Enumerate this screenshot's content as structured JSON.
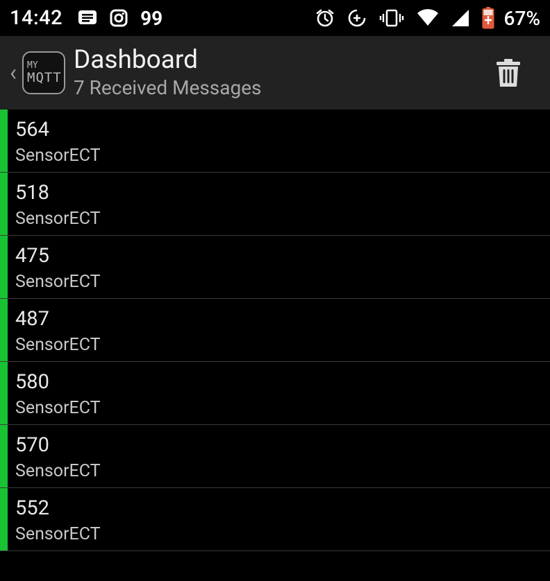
{
  "status_bar": {
    "time": "14:42",
    "notifications": [
      "message-icon",
      "instagram-icon"
    ],
    "badge_text": "99",
    "system_icons": [
      "alarm-icon",
      "data-saver-icon",
      "vibrate-icon",
      "wifi-icon",
      "signal-icon",
      "battery-charging-icon"
    ],
    "battery_percent": "67%"
  },
  "app_bar": {
    "logo_line1": "MY",
    "logo_line2": "MQTT",
    "title": "Dashboard",
    "subtitle": "7 Received Messages",
    "action_icon": "trash-icon"
  },
  "colors": {
    "accent_green": "#19c233",
    "app_bar_bg": "#222222",
    "background": "#000000"
  },
  "messages": [
    {
      "value": "564",
      "topic": "SensorECT"
    },
    {
      "value": "518",
      "topic": "SensorECT"
    },
    {
      "value": "475",
      "topic": "SensorECT"
    },
    {
      "value": "487",
      "topic": "SensorECT"
    },
    {
      "value": "580",
      "topic": "SensorECT"
    },
    {
      "value": "570",
      "topic": "SensorECT"
    },
    {
      "value": "552",
      "topic": "SensorECT"
    }
  ]
}
